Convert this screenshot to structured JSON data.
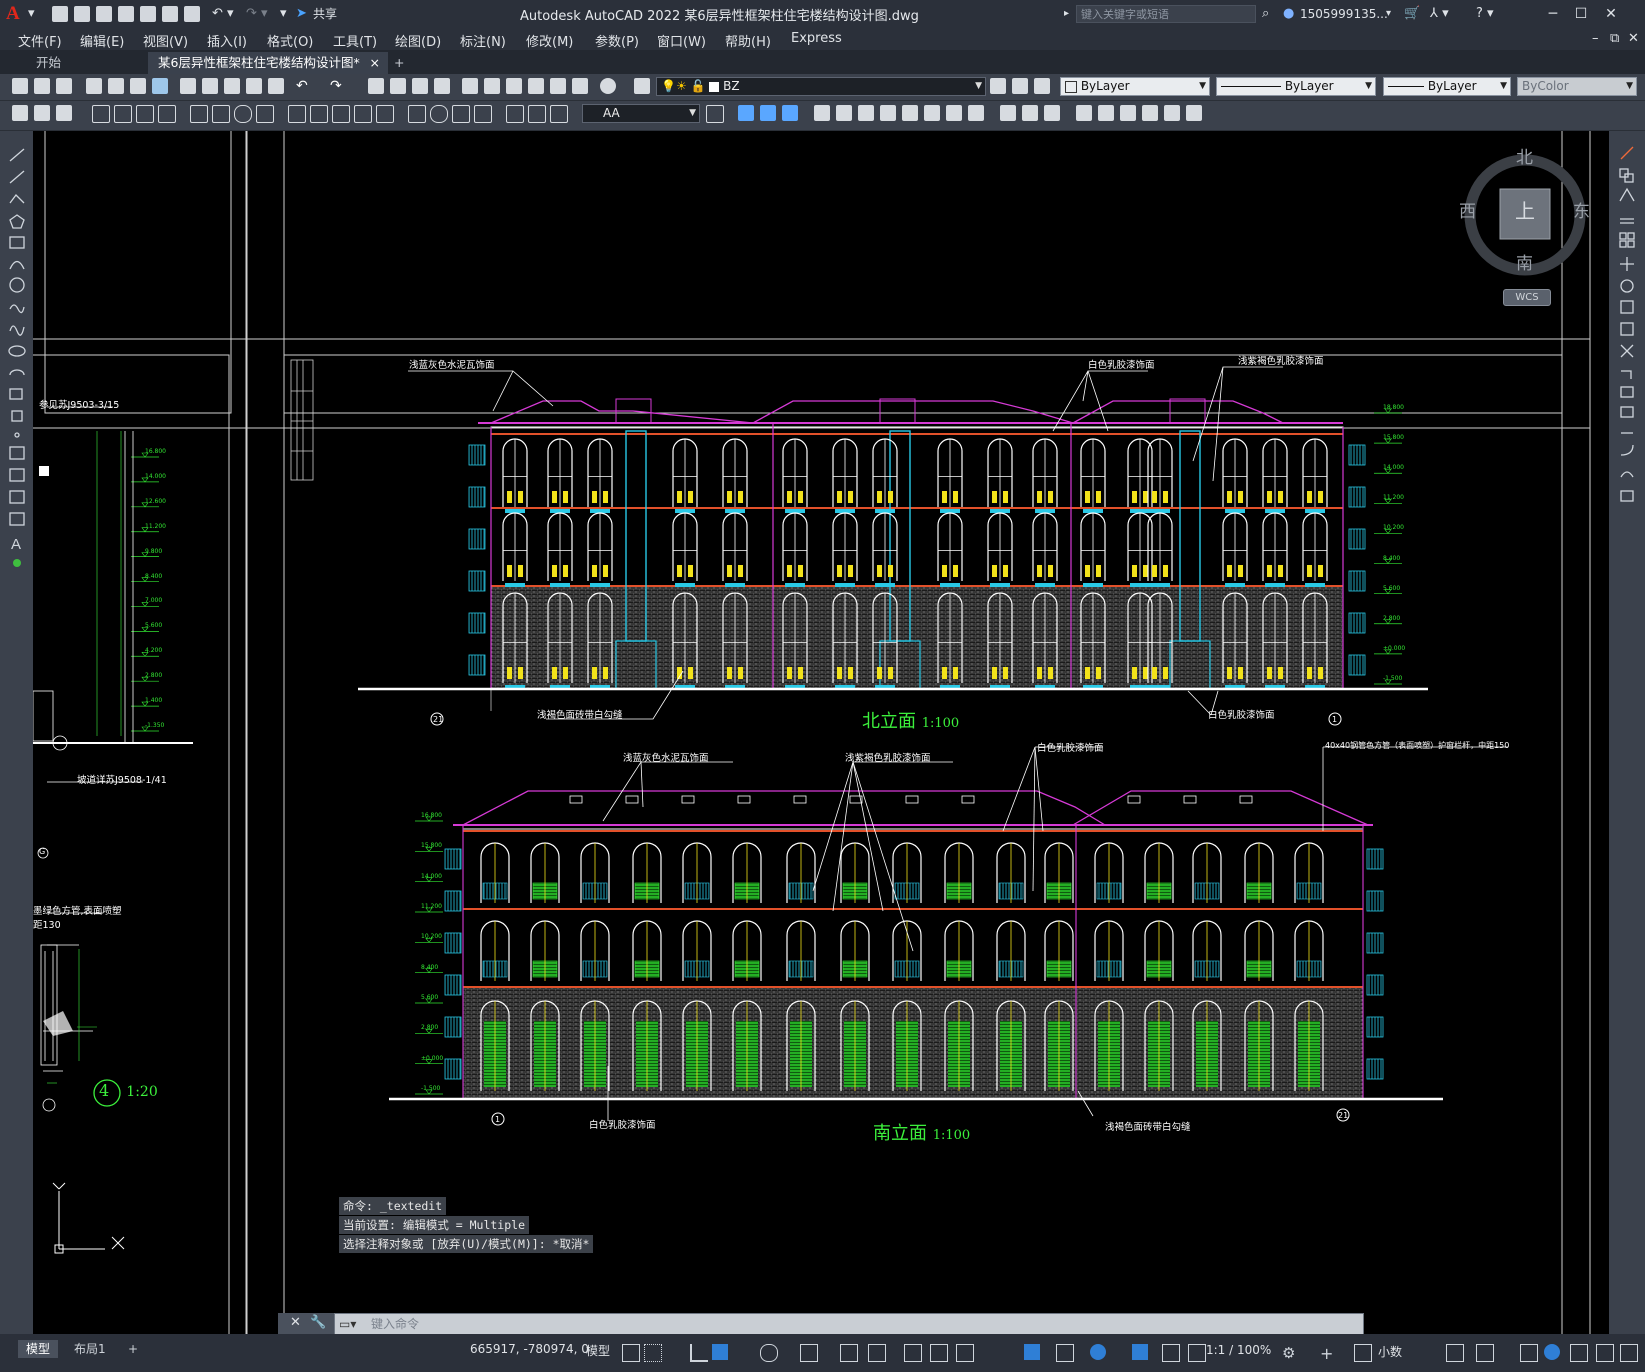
{
  "app": {
    "logo": "A",
    "title": "Autodesk AutoCAD 2022    某6层异性框架柱住宅楼结构设计图.dwg",
    "share_label": "共享",
    "search_placeholder": "键入关键字或短语",
    "user": "1505999135...",
    "window_controls": [
      "minimize-icon",
      "maximize-icon",
      "close-icon"
    ]
  },
  "menu": [
    "文件(F)",
    "编辑(E)",
    "视图(V)",
    "插入(I)",
    "格式(O)",
    "工具(T)",
    "绘图(D)",
    "标注(N)",
    "修改(M)",
    "参数(P)",
    "窗口(W)",
    "帮助(H)",
    "Express"
  ],
  "tabs": {
    "start": "开始",
    "active": "某6层异性框架柱住宅楼结构设计图*",
    "close": "×",
    "add": "+"
  },
  "toolbar": {
    "layer": "BZ",
    "color": "ByLayer",
    "linetype": "ByLayer",
    "lineweight": "ByLayer",
    "plotstyle": "ByColor",
    "textstyle": "AA"
  },
  "viewcube": {
    "north": "北",
    "south": "南",
    "east": "东",
    "west": "西",
    "top": "上",
    "wcs": "WCS"
  },
  "drawing": {
    "north_title": "北立面",
    "north_scale": "1:100",
    "south_title": "南立面",
    "south_scale": "1:100",
    "detail_num": "4",
    "detail_scale": "1:20",
    "notes": {
      "n1": "浅蓝灰色水泥瓦饰面",
      "n2": "白色乳胶漆饰面",
      "n3": "浅紫褐色乳胶漆饰面",
      "n4": "浅褐色面砖带白勾缝",
      "n5": "白色乳胶漆饰面",
      "s1": "浅蓝灰色水泥瓦饰面",
      "s2": "浅紫褐色乳胶漆饰面",
      "s3": "白色乳胶漆饰面",
      "s4": "40x40钢管色方管（表面喷塑）护窗栏杆，中距150",
      "s5": "白色乳胶漆饰面",
      "s6": "浅褐色面砖带白勾缝",
      "l1": "参见苏J9503-3/15",
      "l2": "坡道详苏J9508-1/41",
      "l3": "墨绿色方管,表面喷塑",
      "l4": "距130"
    },
    "north_levels": [
      "18.800",
      "15.800",
      "14.000",
      "11.200",
      "10.200",
      "8.400",
      "5.600",
      "2.800",
      "±0.000",
      "-1.500"
    ],
    "south_levels": [
      "16.800",
      "15.800",
      "14.000",
      "11.200",
      "10.200",
      "8.400",
      "5.600",
      "2.800",
      "±0.000",
      "-1.500"
    ],
    "left_levels": [
      "16.800",
      "14.000",
      "12.600",
      "11.200",
      "9.800",
      "8.400",
      "7.000",
      "5.600",
      "4.200",
      "2.800",
      "1.400",
      "-1.350"
    ],
    "axis_left": "21",
    "axis_right": "1",
    "axis_g": "G"
  },
  "command": {
    "line1": "命令:  _textedit",
    "line2": "当前设置: 编辑模式 = Multiple",
    "line3": "选择注释对象或 [放弃(U)/模式(M)]: *取消*",
    "placeholder": "键入命令"
  },
  "status": {
    "model_tab": "模型",
    "layout_tab": "布局1",
    "add": "+",
    "coords": "665917, -780974, 0",
    "model": "模型",
    "scale": "1:1 / 100%",
    "units": "小数"
  }
}
